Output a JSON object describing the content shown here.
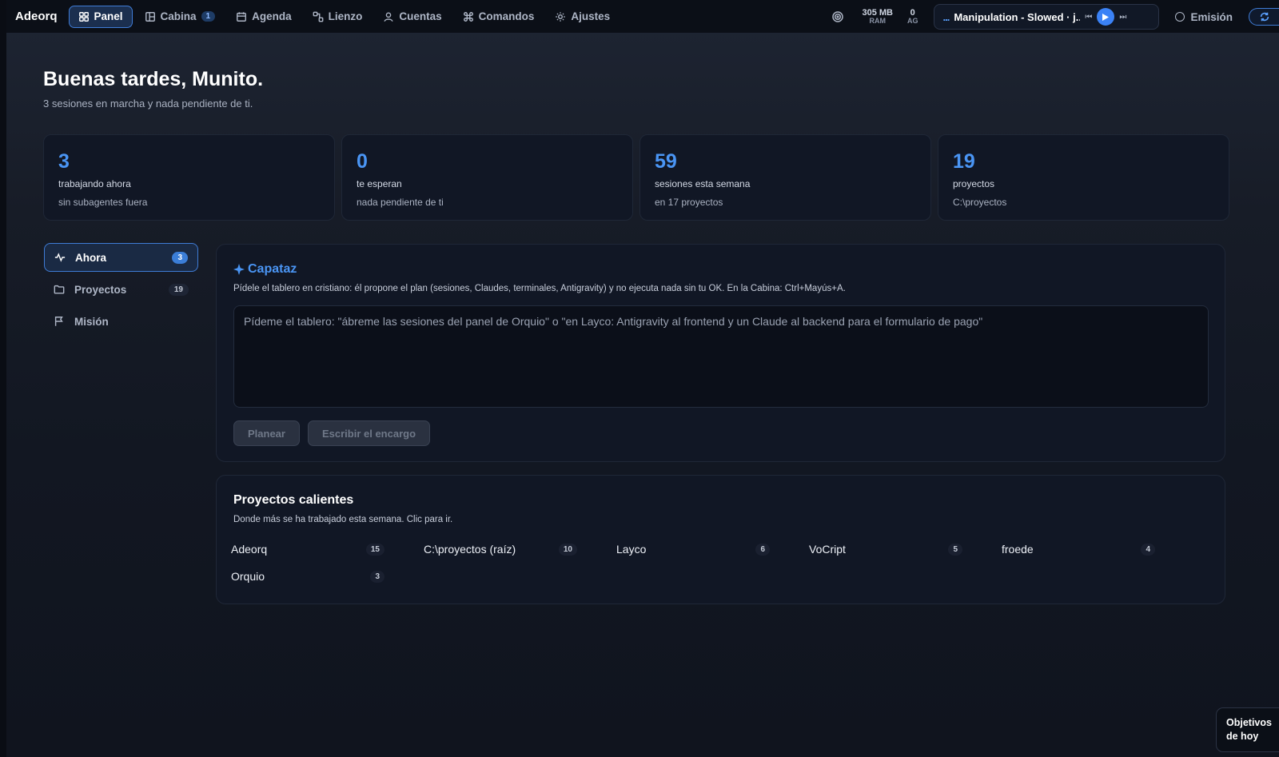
{
  "app": {
    "brand": "Adeorq"
  },
  "nav": [
    {
      "label": "Panel",
      "icon": "grid-icon",
      "active": true
    },
    {
      "label": "Cabina",
      "icon": "layout-icon",
      "badge": "1"
    },
    {
      "label": "Agenda",
      "icon": "calendar-icon"
    },
    {
      "label": "Lienzo",
      "icon": "nodes-icon"
    },
    {
      "label": "Cuentas",
      "icon": "user-icon"
    },
    {
      "label": "Comandos",
      "icon": "command-icon"
    },
    {
      "label": "Ajustes",
      "icon": "sun-icon"
    }
  ],
  "status": {
    "ram_value": "305 MB",
    "ram_label": "RAM",
    "ag_value": "0",
    "ag_label": "AG"
  },
  "player": {
    "indicator": "...",
    "track": "Manipulation - Slowed · j...",
    "state": "playing"
  },
  "emision": {
    "label": "Emisión"
  },
  "header": {
    "greeting": "Buenas tardes, Munito.",
    "subtitle": "3 sesiones en marcha y nada pendiente de ti."
  },
  "stats": [
    {
      "value": "3",
      "label": "trabajando ahora",
      "sub": "sin subagentes fuera"
    },
    {
      "value": "0",
      "label": "te esperan",
      "sub": "nada pendiente de ti"
    },
    {
      "value": "59",
      "label": "sesiones esta semana",
      "sub": "en 17 proyectos"
    },
    {
      "value": "19",
      "label": "proyectos",
      "sub": "C:\\proyectos"
    }
  ],
  "sidebar": [
    {
      "label": "Ahora",
      "icon": "activity-icon",
      "badge": "3",
      "active": true
    },
    {
      "label": "Proyectos",
      "icon": "folder-icon",
      "badge": "19"
    },
    {
      "label": "Misión",
      "icon": "flag-icon"
    }
  ],
  "capataz": {
    "title": "Capataz",
    "icon": "sparkle-icon",
    "description": "Pídele el tablero en cristiano: él propone el plan (sesiones, Claudes, terminales, Antigravity) y no ejecuta nada sin tu OK. En la Cabina: Ctrl+Mayús+A.",
    "placeholder": "Pídeme el tablero: \"ábreme las sesiones del panel de Orquio\" o \"en Layco: Antigravity al frontend y un Claude al backend para el formulario de pago\"",
    "plan_button": "Planear",
    "write_button": "Escribir el encargo"
  },
  "hot_projects": {
    "title": "Proyectos calientes",
    "description": "Donde más se ha trabajado esta semana. Clic para ir.",
    "items": [
      {
        "name": "Adeorq",
        "count": "15"
      },
      {
        "name": "C:\\proyectos (raíz)",
        "count": "10"
      },
      {
        "name": "Layco",
        "count": "6"
      },
      {
        "name": "VoCript",
        "count": "5"
      },
      {
        "name": "froede",
        "count": "4"
      },
      {
        "name": "Orquio",
        "count": "3"
      }
    ]
  },
  "objetivos": {
    "label": "Objetivos de hoy"
  },
  "colors": {
    "accent": "#4a95f4",
    "accent_border": "#3f7cd6",
    "background": "#121722",
    "card": "#111725"
  }
}
